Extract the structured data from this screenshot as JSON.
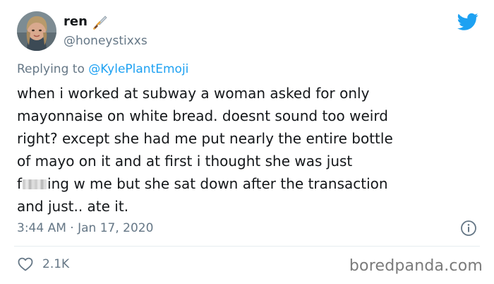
{
  "author": {
    "name": "ren",
    "handle": "@honeystixxs",
    "name_emoji": "dagger-icon"
  },
  "reply": {
    "prefix": "Replying to",
    "to": "@KylePlantEmoji"
  },
  "tweet": {
    "lines": [
      "when i worked at subway a woman asked for only",
      "mayonnaise on white bread. doesnt sound too weird",
      "right? except she had me put nearly the entire bottle",
      "of mayo on it and at first i thought she was just",
      "",
      "and just.. ate it."
    ],
    "censored_line": {
      "before": "f",
      "after": "ing w me but she sat down after the transaction"
    }
  },
  "meta": {
    "timestamp": "3:44 AM · Jan 17, 2020"
  },
  "actions": {
    "likes": "2.1K"
  },
  "watermark": "boredpanda.com",
  "colors": {
    "brand": "#1da1f2",
    "muted": "#657786",
    "text": "#14171a"
  },
  "icons": {
    "brand": "twitter-bird-icon",
    "info": "info-icon",
    "like": "heart-icon"
  }
}
